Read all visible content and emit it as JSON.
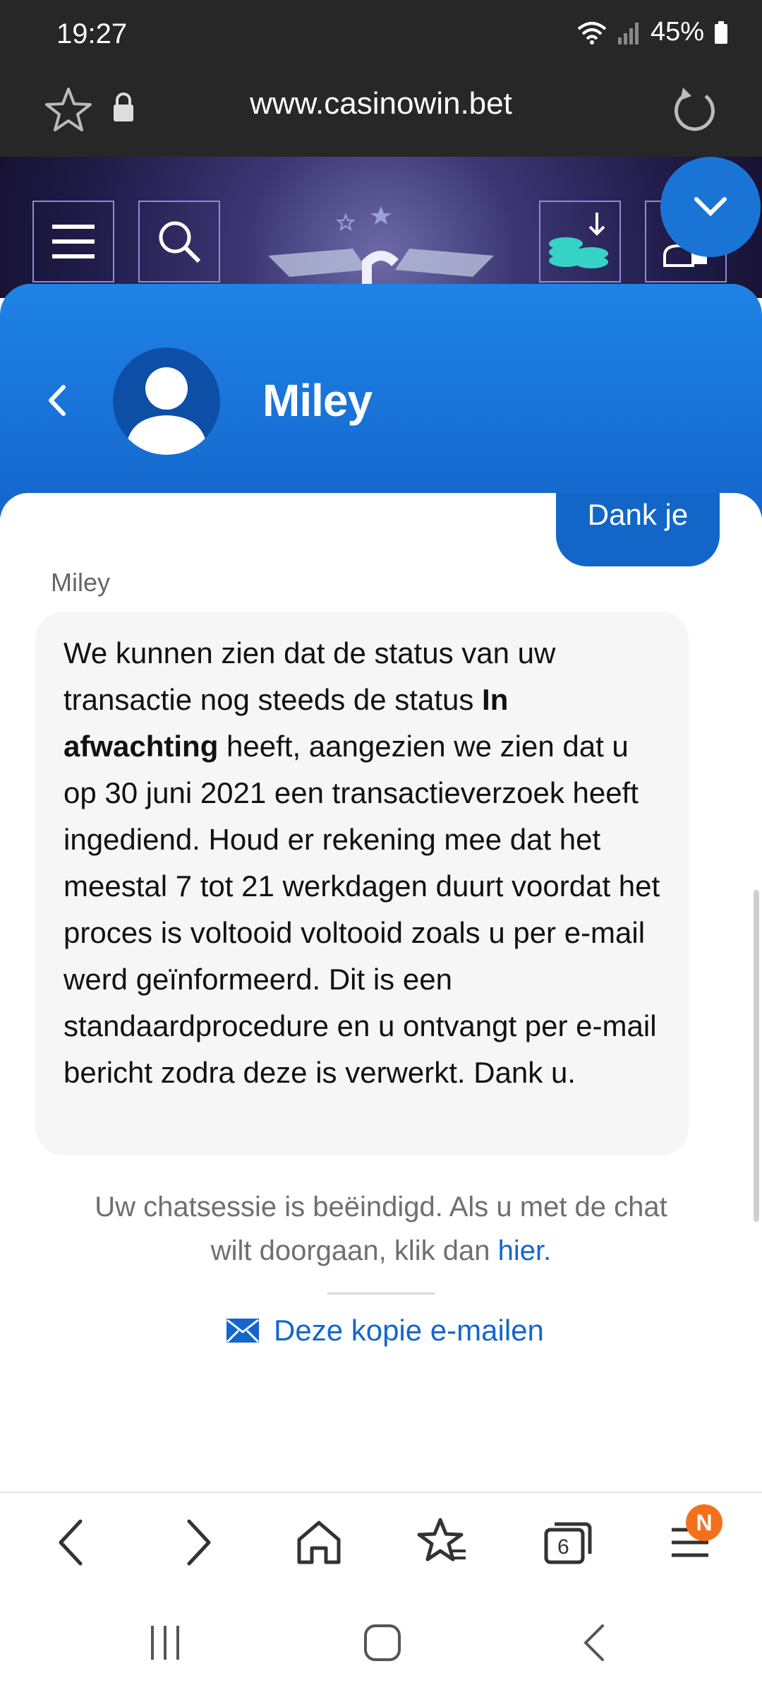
{
  "status_bar": {
    "time": "19:27",
    "battery": "45%"
  },
  "browser": {
    "url": "www.casinowin.bet",
    "tabs_count": "6",
    "notification_badge": "N"
  },
  "chat": {
    "agent_name": "Miley",
    "sent_message": "Dank je",
    "sender_label": "Miley",
    "message_part1": "We kunnen zien dat de status van uw transactie nog steeds de status ",
    "message_bold": "In afwachting",
    "message_part2": " heeft, aangezien we zien dat u op 30 juni 2021 een transactieverzoek heeft ingediend. Houd er rekening mee dat het meestal 7 tot 21 werkdagen duurt voordat het proces is voltooid voltooid zoals u per e-mail werd geïnformeerd. Dit is een standaardprocedure en u ontvangt per e-mail bericht zodra deze is verwerkt. Dank u.",
    "ended_text": "Uw chatsessie is beëindigd. Als u met de chat wilt doorgaan, klik dan ",
    "ended_link": "hier.",
    "email_copy": "Deze kopie e-mailen"
  },
  "icons": [
    "star-icon",
    "lock-icon",
    "reload-icon",
    "menu-icon",
    "search-icon",
    "coins-download-icon",
    "user-lock-icon",
    "chevron-down-icon",
    "back-icon",
    "avatar-icon",
    "mail-icon",
    "nav-back-icon",
    "nav-forward-icon",
    "home-icon",
    "bookmarks-icon",
    "tabs-icon",
    "menu-lines-icon"
  ],
  "colors": {
    "brand_blue": "#1466cc",
    "header_dark": "#272727",
    "badge_orange": "#f5701a"
  }
}
